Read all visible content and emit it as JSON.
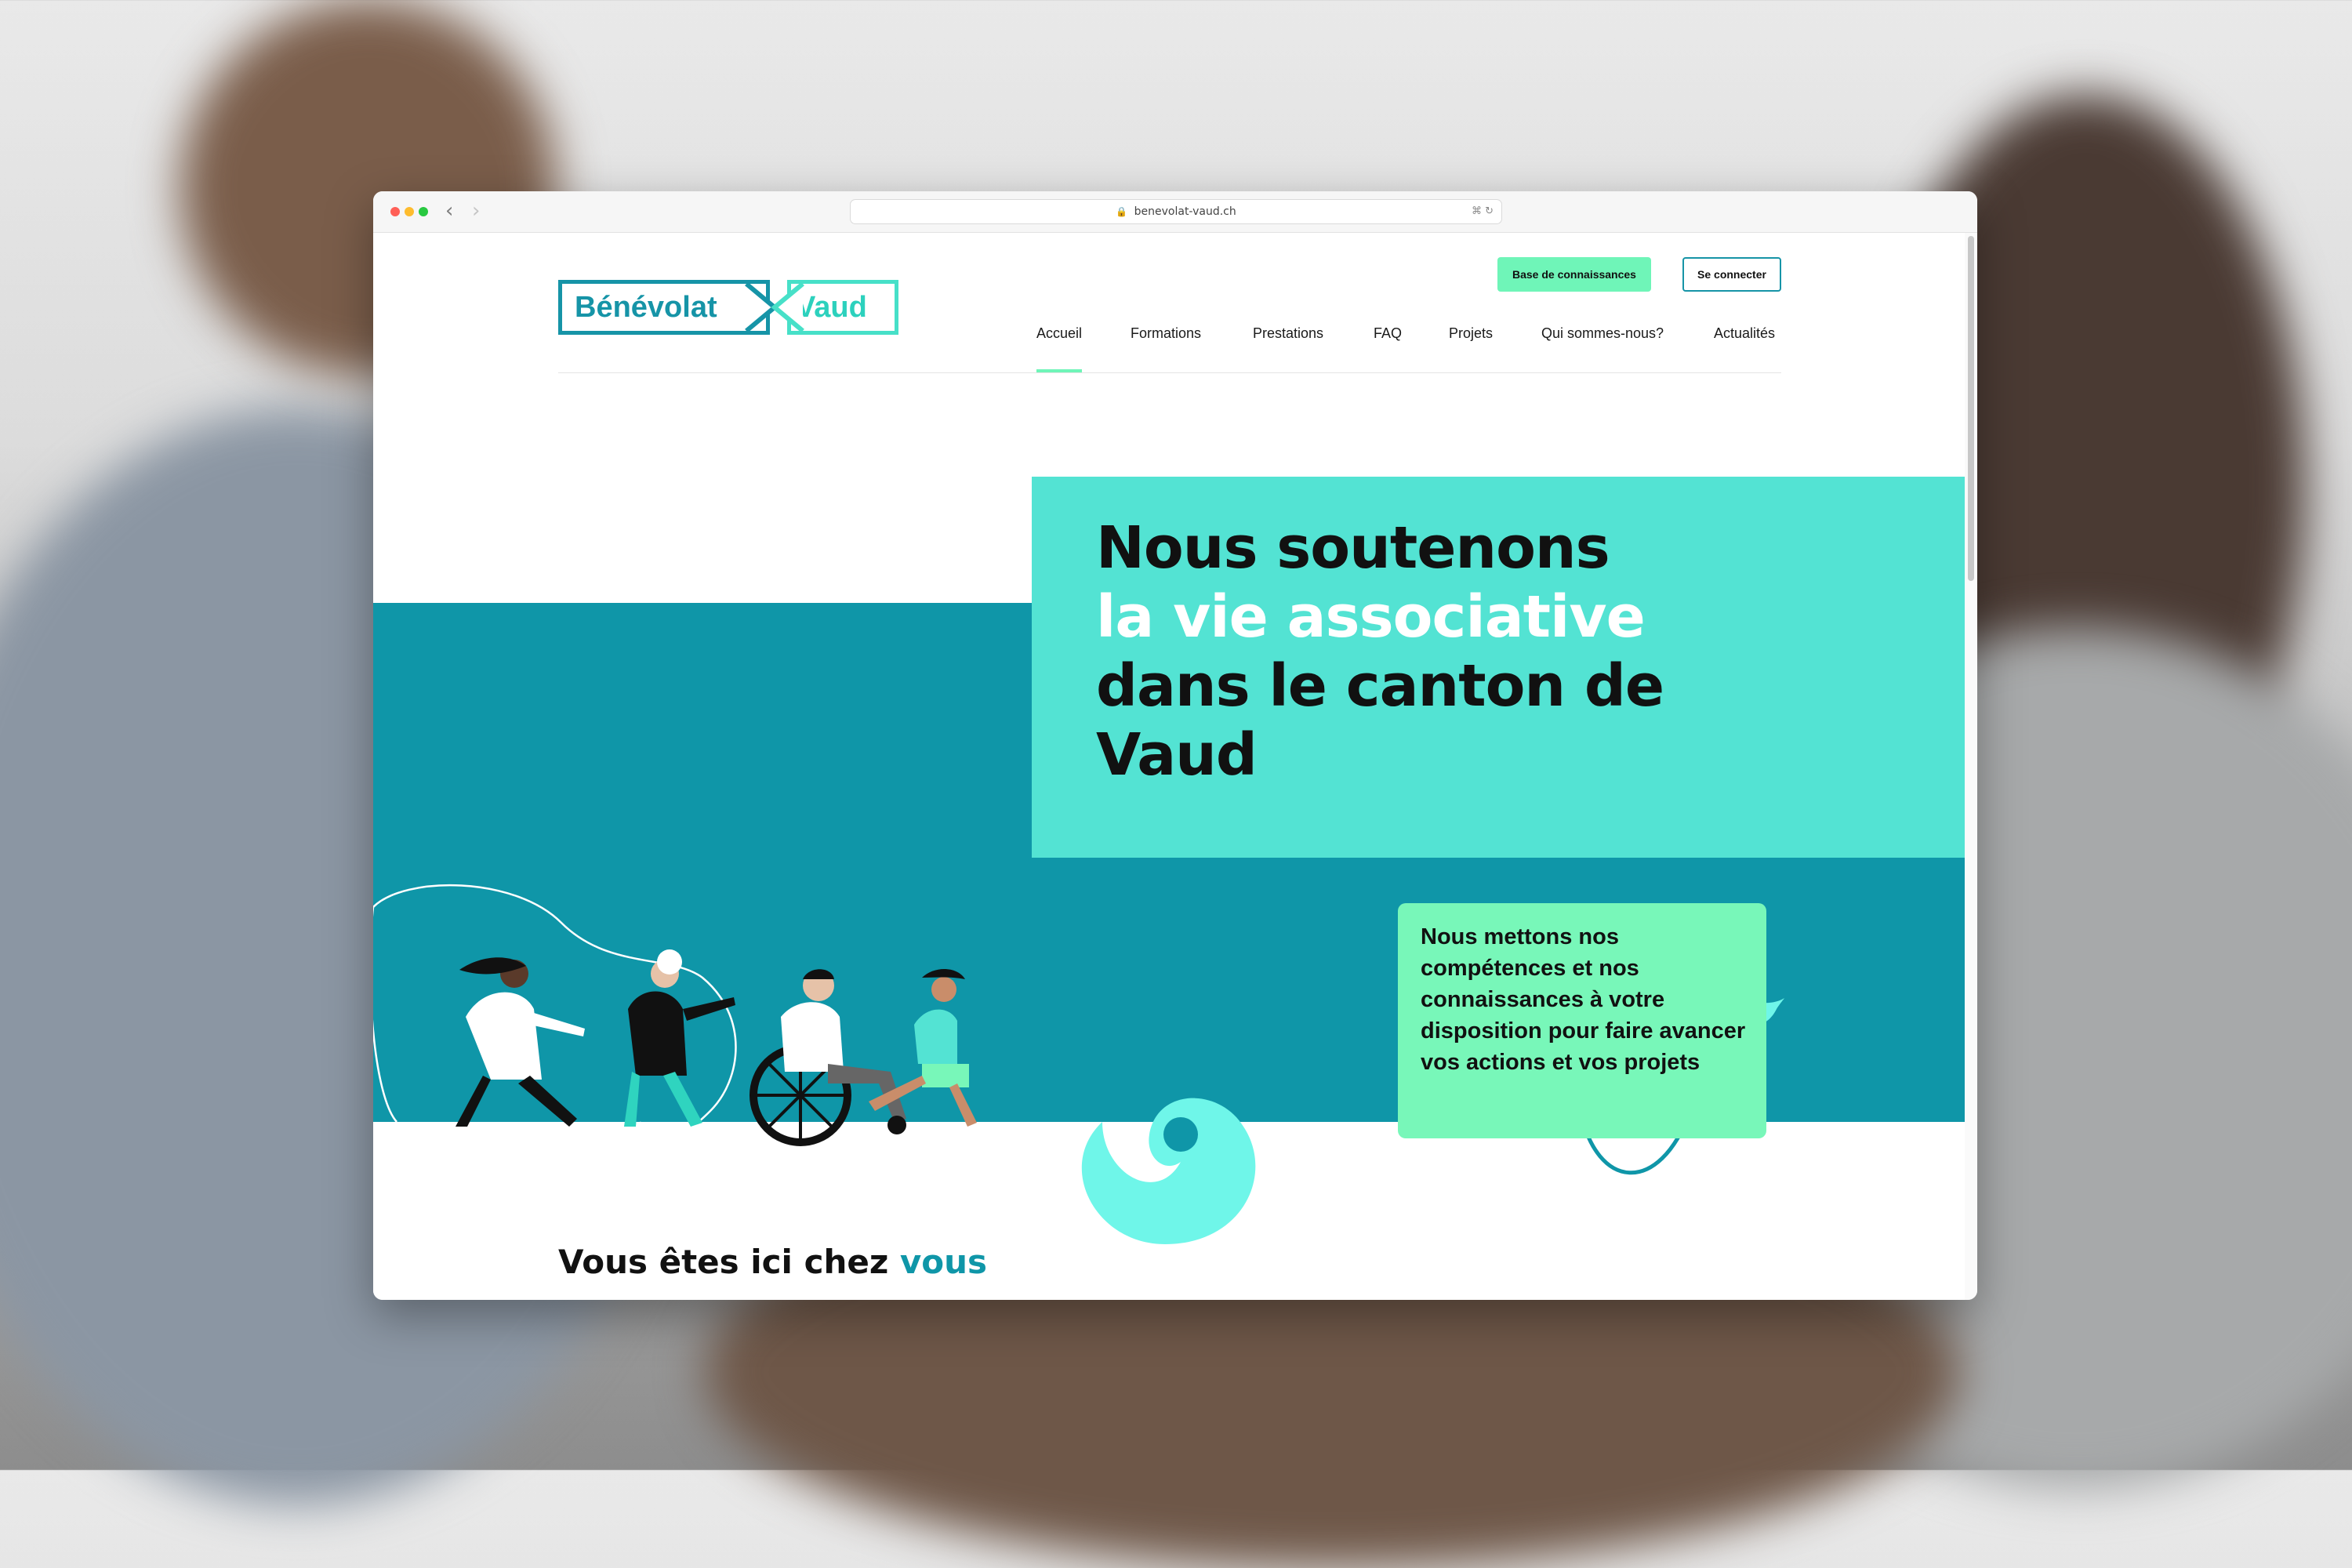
{
  "browser": {
    "url": "benevolat-vaud.ch",
    "back_glyph": "‹",
    "forward_glyph": "›",
    "lock_glyph": "🔒",
    "tools_glyph": "⌘ ↻"
  },
  "logo": {
    "left_text": "Bénévolat",
    "right_text": "Vaud",
    "colors": {
      "primary": "#1694a7",
      "accent": "#47e0c8"
    }
  },
  "header": {
    "knowledge_button": "Base de connaissances",
    "login_button": "Se connecter",
    "nav": [
      "Accueil",
      "Formations",
      "Prestations",
      "FAQ",
      "Projets",
      "Qui sommes-nous?",
      "Actualités"
    ],
    "active_nav": "Accueil"
  },
  "hero": {
    "title_line1": "Nous soutenons",
    "title_line2": "la vie associative",
    "title_line3": "dans le canton de",
    "title_line4": "Vaud",
    "info": "Nous mettons nos compétences et nos connaissances à votre disposition pour faire avancer vos actions et vos projets"
  },
  "section": {
    "title": "Vous êtes ici chez",
    "title_accent": "vous"
  },
  "colors": {
    "teal_band": "#0f96a8",
    "card_turquoise": "#53e3d3",
    "mint": "#78f7b9",
    "button_mint": "#6ff5b8"
  }
}
